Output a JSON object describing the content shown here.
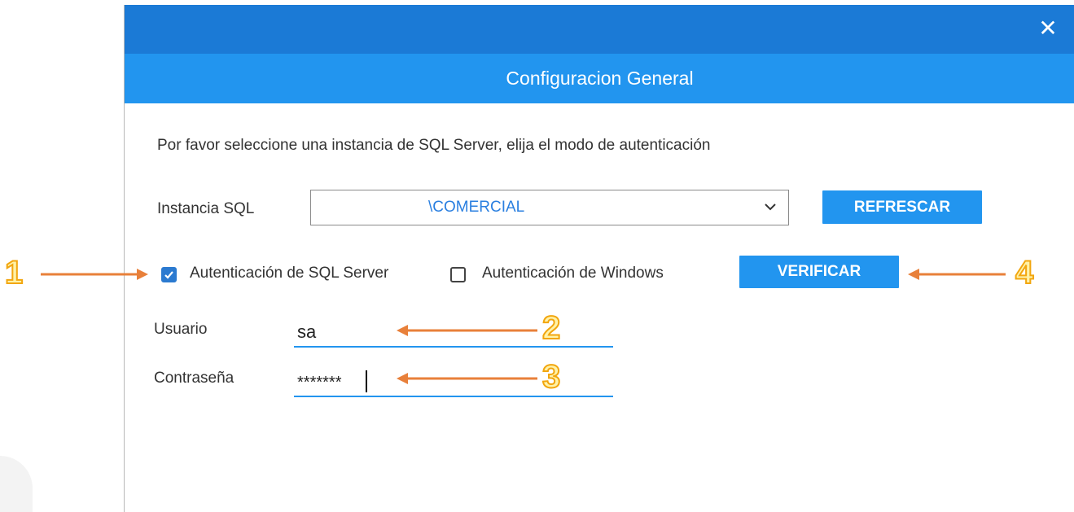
{
  "dialog": {
    "close_glyph": "✕",
    "header_title": "Configuracion General",
    "intro_text": "Por favor seleccione una instancia de SQL Server, elija el modo de autenticación",
    "instance": {
      "label": "Instancia SQL",
      "value": "\\COMERCIAL",
      "refresh_label": "REFRESCAR"
    },
    "auth": {
      "sql_label": "Autenticación de SQL Server",
      "sql_checked": true,
      "windows_label": "Autenticación de Windows",
      "windows_checked": false,
      "verify_label": "VERIFICAR"
    },
    "user": {
      "label": "Usuario",
      "value": "sa"
    },
    "password": {
      "label": "Contraseña",
      "value": "*******"
    }
  },
  "annotations": {
    "labels": [
      "1",
      "2",
      "3",
      "4"
    ],
    "arrow_color": "#e8803a",
    "number_fill": "#fff2a8",
    "number_stroke": "#f2a60f"
  },
  "colors": {
    "titlebar": "#1b7ad6",
    "header": "#2295ef",
    "button": "#2295ef",
    "select_text": "#2a7fe0",
    "checkbox_checked": "#2b7ad0"
  }
}
